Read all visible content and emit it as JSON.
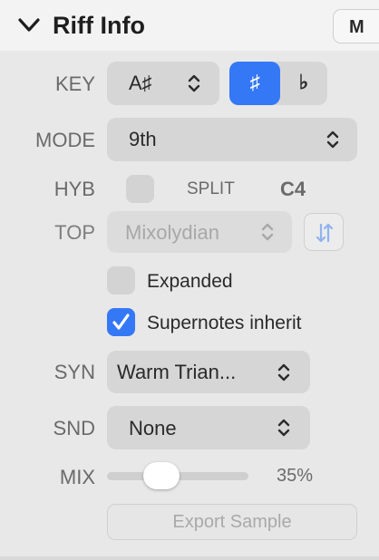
{
  "header": {
    "title": "Riff Info",
    "m_button_label": "M",
    "chevron_icon": "chevron-down-icon"
  },
  "key": {
    "label": "KEY",
    "value": "A♯",
    "sharp_label": "♯",
    "flat_label": "♭",
    "selected_accidental": "sharp"
  },
  "mode": {
    "label": "MODE",
    "value": "9th"
  },
  "hyb": {
    "label": "HYB",
    "checked": false,
    "split_label": "SPLIT",
    "split_value": "C4"
  },
  "top": {
    "label": "TOP",
    "value": "Mixolydian",
    "enabled": false,
    "swap_icon": "swap-arrows-icon"
  },
  "expanded": {
    "label": "Expanded",
    "checked": false
  },
  "supernotes": {
    "label": "Supernotes inherit",
    "checked": true
  },
  "syn": {
    "label": "SYN",
    "value": "Warm Trian..."
  },
  "snd": {
    "label": "SND",
    "value": "None"
  },
  "mix": {
    "label": "MIX",
    "value_text": "35%",
    "fraction": 0.35
  },
  "export": {
    "label": "Export Sample",
    "enabled": false
  },
  "colors": {
    "accent": "#3478f6",
    "panel_bg": "#e8e8e8",
    "control_bg": "#d6d6d6",
    "label_gray": "#6a6a6a",
    "disabled_text": "#a9a9a9"
  }
}
